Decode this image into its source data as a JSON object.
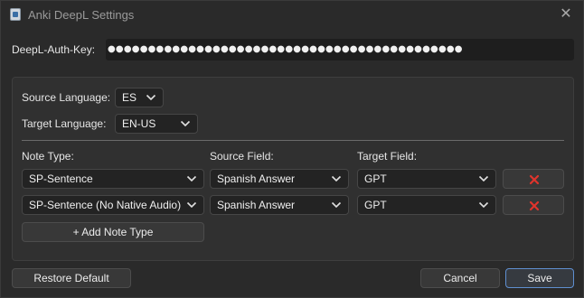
{
  "window": {
    "title": "Anki DeepL Settings",
    "close_glyph": "✕"
  },
  "auth": {
    "label": "DeepL-Auth-Key:",
    "value": "●●●●●●●●●●●●●●●●●●●●●●●●●●●●●●●●●●●●●●●●●●●●"
  },
  "languages": {
    "source_label": "Source Language:",
    "source_value": "ES",
    "target_label": "Target Language:",
    "target_value": "EN-US"
  },
  "mapping": {
    "headers": {
      "note_type": "Note Type:",
      "source_field": "Source Field:",
      "target_field": "Target Field:"
    },
    "rows": [
      {
        "note_type": "SP-Sentence",
        "source_field": "Spanish Answer",
        "target_field": "GPT"
      },
      {
        "note_type": "SP-Sentence (No Native Audio)",
        "source_field": "Spanish Answer",
        "target_field": "GPT"
      }
    ],
    "add_label": "+ Add Note Type"
  },
  "footer": {
    "restore_label": "Restore Default",
    "cancel_label": "Cancel",
    "save_label": "Save"
  },
  "icons": {
    "app": "anki-app-icon",
    "close": "close-icon",
    "dropdown": "chevron-down-icon",
    "delete": "red-x-delete-icon"
  },
  "colors": {
    "window_bg": "#2a2a2a",
    "panel_bg": "#303030",
    "input_bg": "#232323",
    "delete_icon": "#e0342c",
    "primary_border": "#5f8fd0"
  }
}
